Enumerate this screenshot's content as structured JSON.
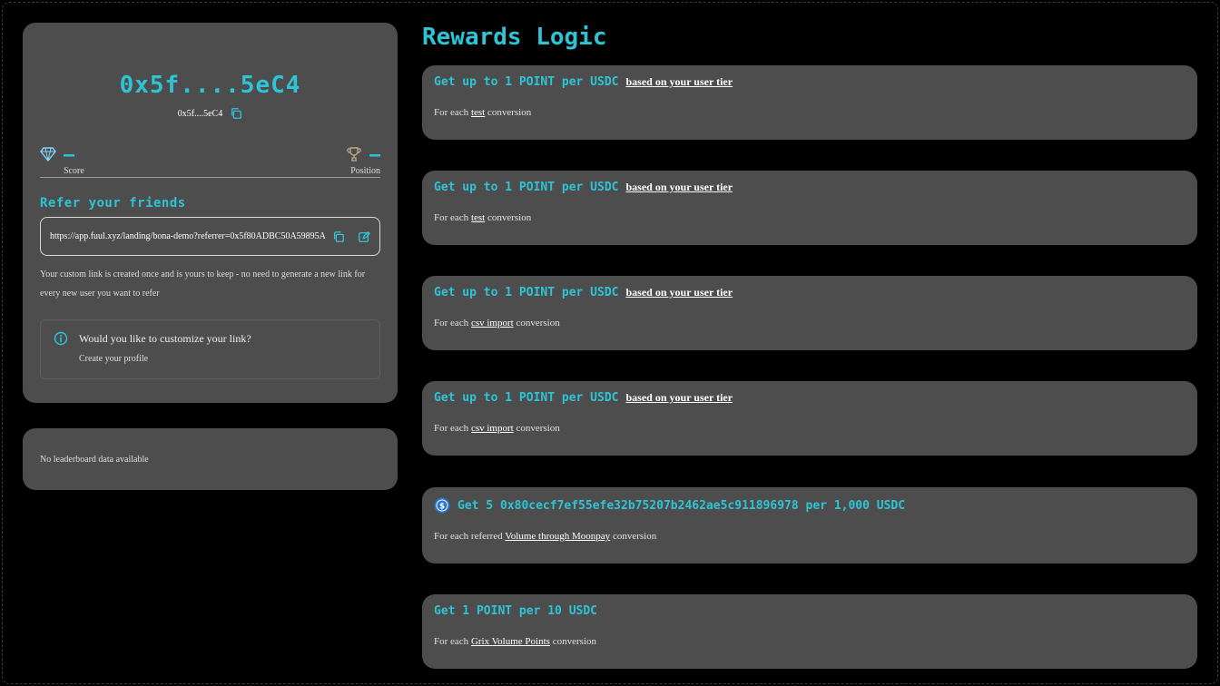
{
  "profile": {
    "wallet_short": "0x5f....5eC4",
    "wallet_sub": "0x5f....5eC4",
    "score_value": "–",
    "score_label": "Score",
    "position_value": "–",
    "position_label": "Position",
    "refer_title": "Refer your friends",
    "referral_link": "https://app.fuul.xyz/landing/bona-demo?referrer=0x5f80ADBC50A59895A...",
    "link_note": "Your custom link is created once and is yours to keep - no need to generate a new link for every new user you want to refer",
    "customize_question": "Would you like to customize your link?",
    "customize_link": "Create your profile"
  },
  "leaderboard": {
    "empty_text": "No leaderboard data available"
  },
  "rewards": {
    "title": "Rewards Logic",
    "items": [
      {
        "main": "Get up to 1 POINT per USDC",
        "tier": "based on your user tier",
        "prefix": "For each ",
        "action": "test",
        "suffix": " conversion"
      },
      {
        "main": "Get up to 1 POINT per USDC",
        "tier": "based on your user tier",
        "prefix": "For each ",
        "action": "test",
        "suffix": " conversion"
      },
      {
        "main": "Get up to 1 POINT per USDC",
        "tier": "based on your user tier",
        "prefix": "For each ",
        "action": "csv import",
        "suffix": " conversion"
      },
      {
        "main": "Get up to 1 POINT per USDC",
        "tier": "based on your user tier",
        "prefix": "For each ",
        "action": "csv import",
        "suffix": " conversion"
      },
      {
        "main": "Get 5 0x80cecf7ef55efe32b75207b2462ae5c911896978 per 1,000 USDC",
        "tier": "",
        "prefix": "For each referred ",
        "action": "Volume through Moonpay",
        "suffix": " conversion",
        "icon": "usdc-coin-icon"
      },
      {
        "main": "Get 1 POINT per 10 USDC",
        "tier": "",
        "prefix": "For each ",
        "action": "Grix Volume Points",
        "suffix": " conversion"
      }
    ]
  },
  "colors": {
    "accent": "#2ec4d6",
    "card": "#4d4d4d",
    "background": "#000000"
  }
}
